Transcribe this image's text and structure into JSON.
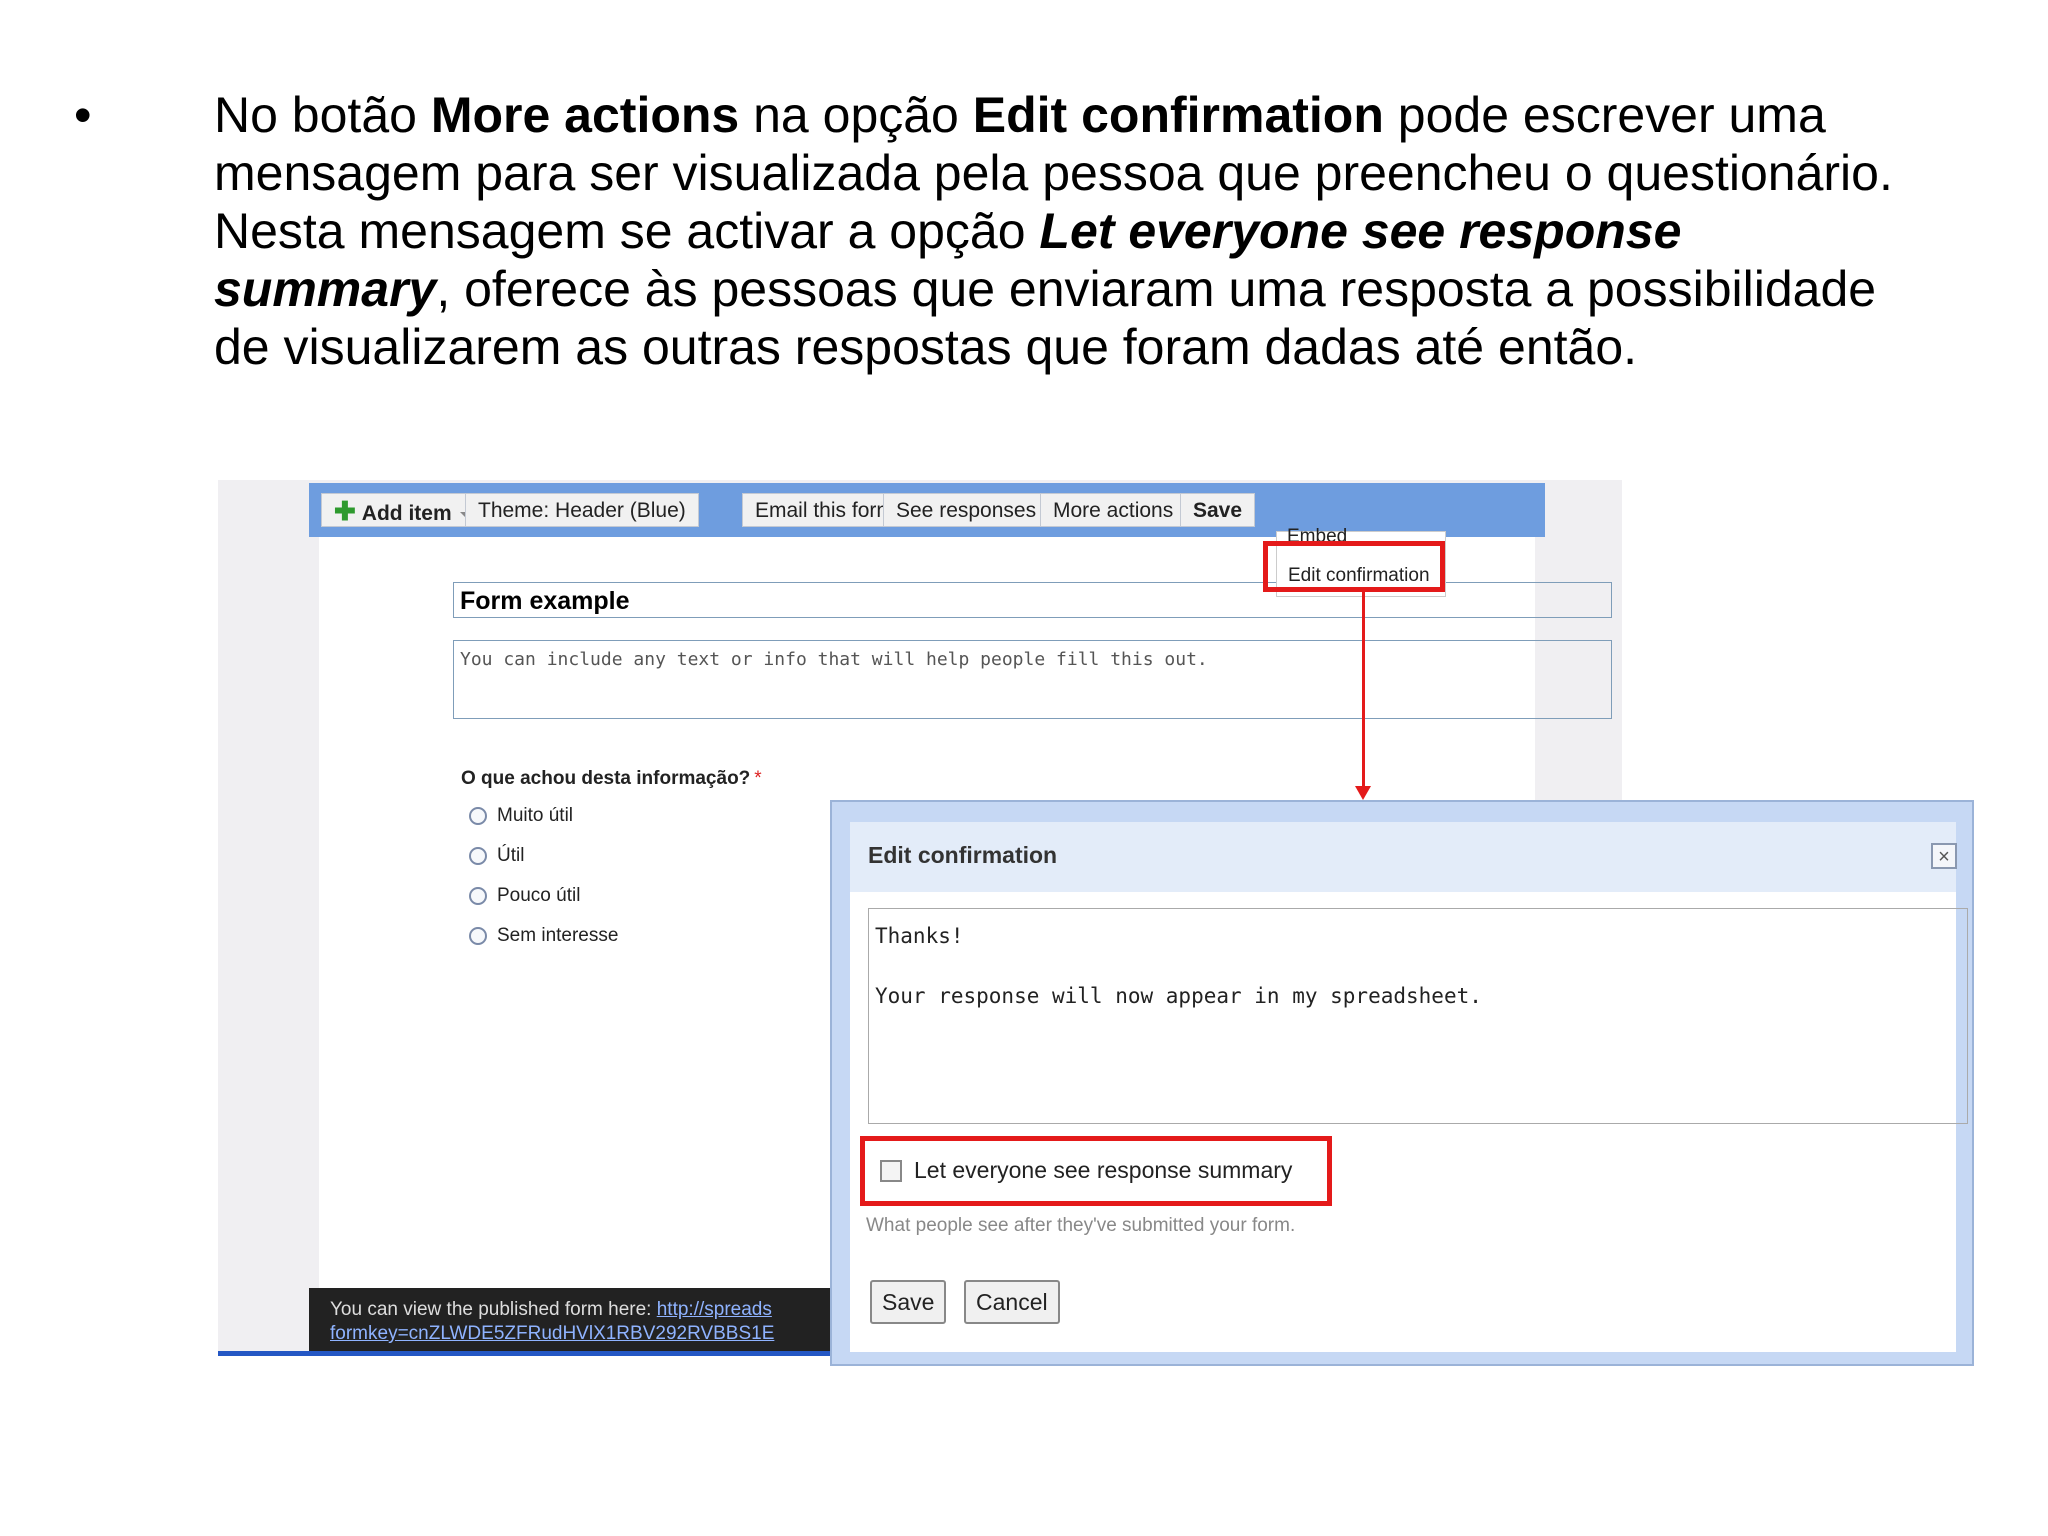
{
  "slide": {
    "bullet": "•",
    "p1": "No botão ",
    "b1": "More actions",
    "p2": " na opção ",
    "b2": "Edit confirmation",
    "p3": " pode escrever uma mensagem para ser visualizada pela pessoa que preencheu o questionário. Nesta mensagem se activar a opção ",
    "b3": "Let everyone see response summary",
    "p4": ", oferece às pessoas que enviaram uma resposta a possibilidade de visualizarem as outras respostas que foram dadas até então."
  },
  "toolbar": {
    "add_item": "Add item",
    "theme": "Theme:  Header (Blue)",
    "email": "Email this form",
    "see_responses": "See responses",
    "more_actions": "More actions",
    "save": "Save"
  },
  "menu": {
    "embed": "Embed",
    "edit_confirmation": "Edit confirmation"
  },
  "form": {
    "title": "Form example",
    "description": "You can include any text or info that will help people fill this out.",
    "question": "O que achou desta informação?",
    "required_mark": "*",
    "options": [
      "Muito útil",
      "Útil",
      "Pouco útil",
      "Sem interesse"
    ]
  },
  "published": {
    "label": "You can view the published form here:",
    "link1": "http://spreads",
    "link2": "formkey=cnZLWDE5ZFRudHVlX1RBV292RVBBS1E"
  },
  "dialog": {
    "title": "Edit confirmation",
    "close": "×",
    "message": "Thanks!\n\nYour response will now appear in my spreadsheet.",
    "checkbox_label": "Let everyone see response summary",
    "checkbox_checked": false,
    "hint": "What people see after they've submitted your form.",
    "save": "Save",
    "cancel": "Cancel"
  },
  "colors": {
    "highlight": "#e41a1a",
    "toolbar": "#6e9ddf",
    "dialog_frame": "#c6d8f4"
  }
}
